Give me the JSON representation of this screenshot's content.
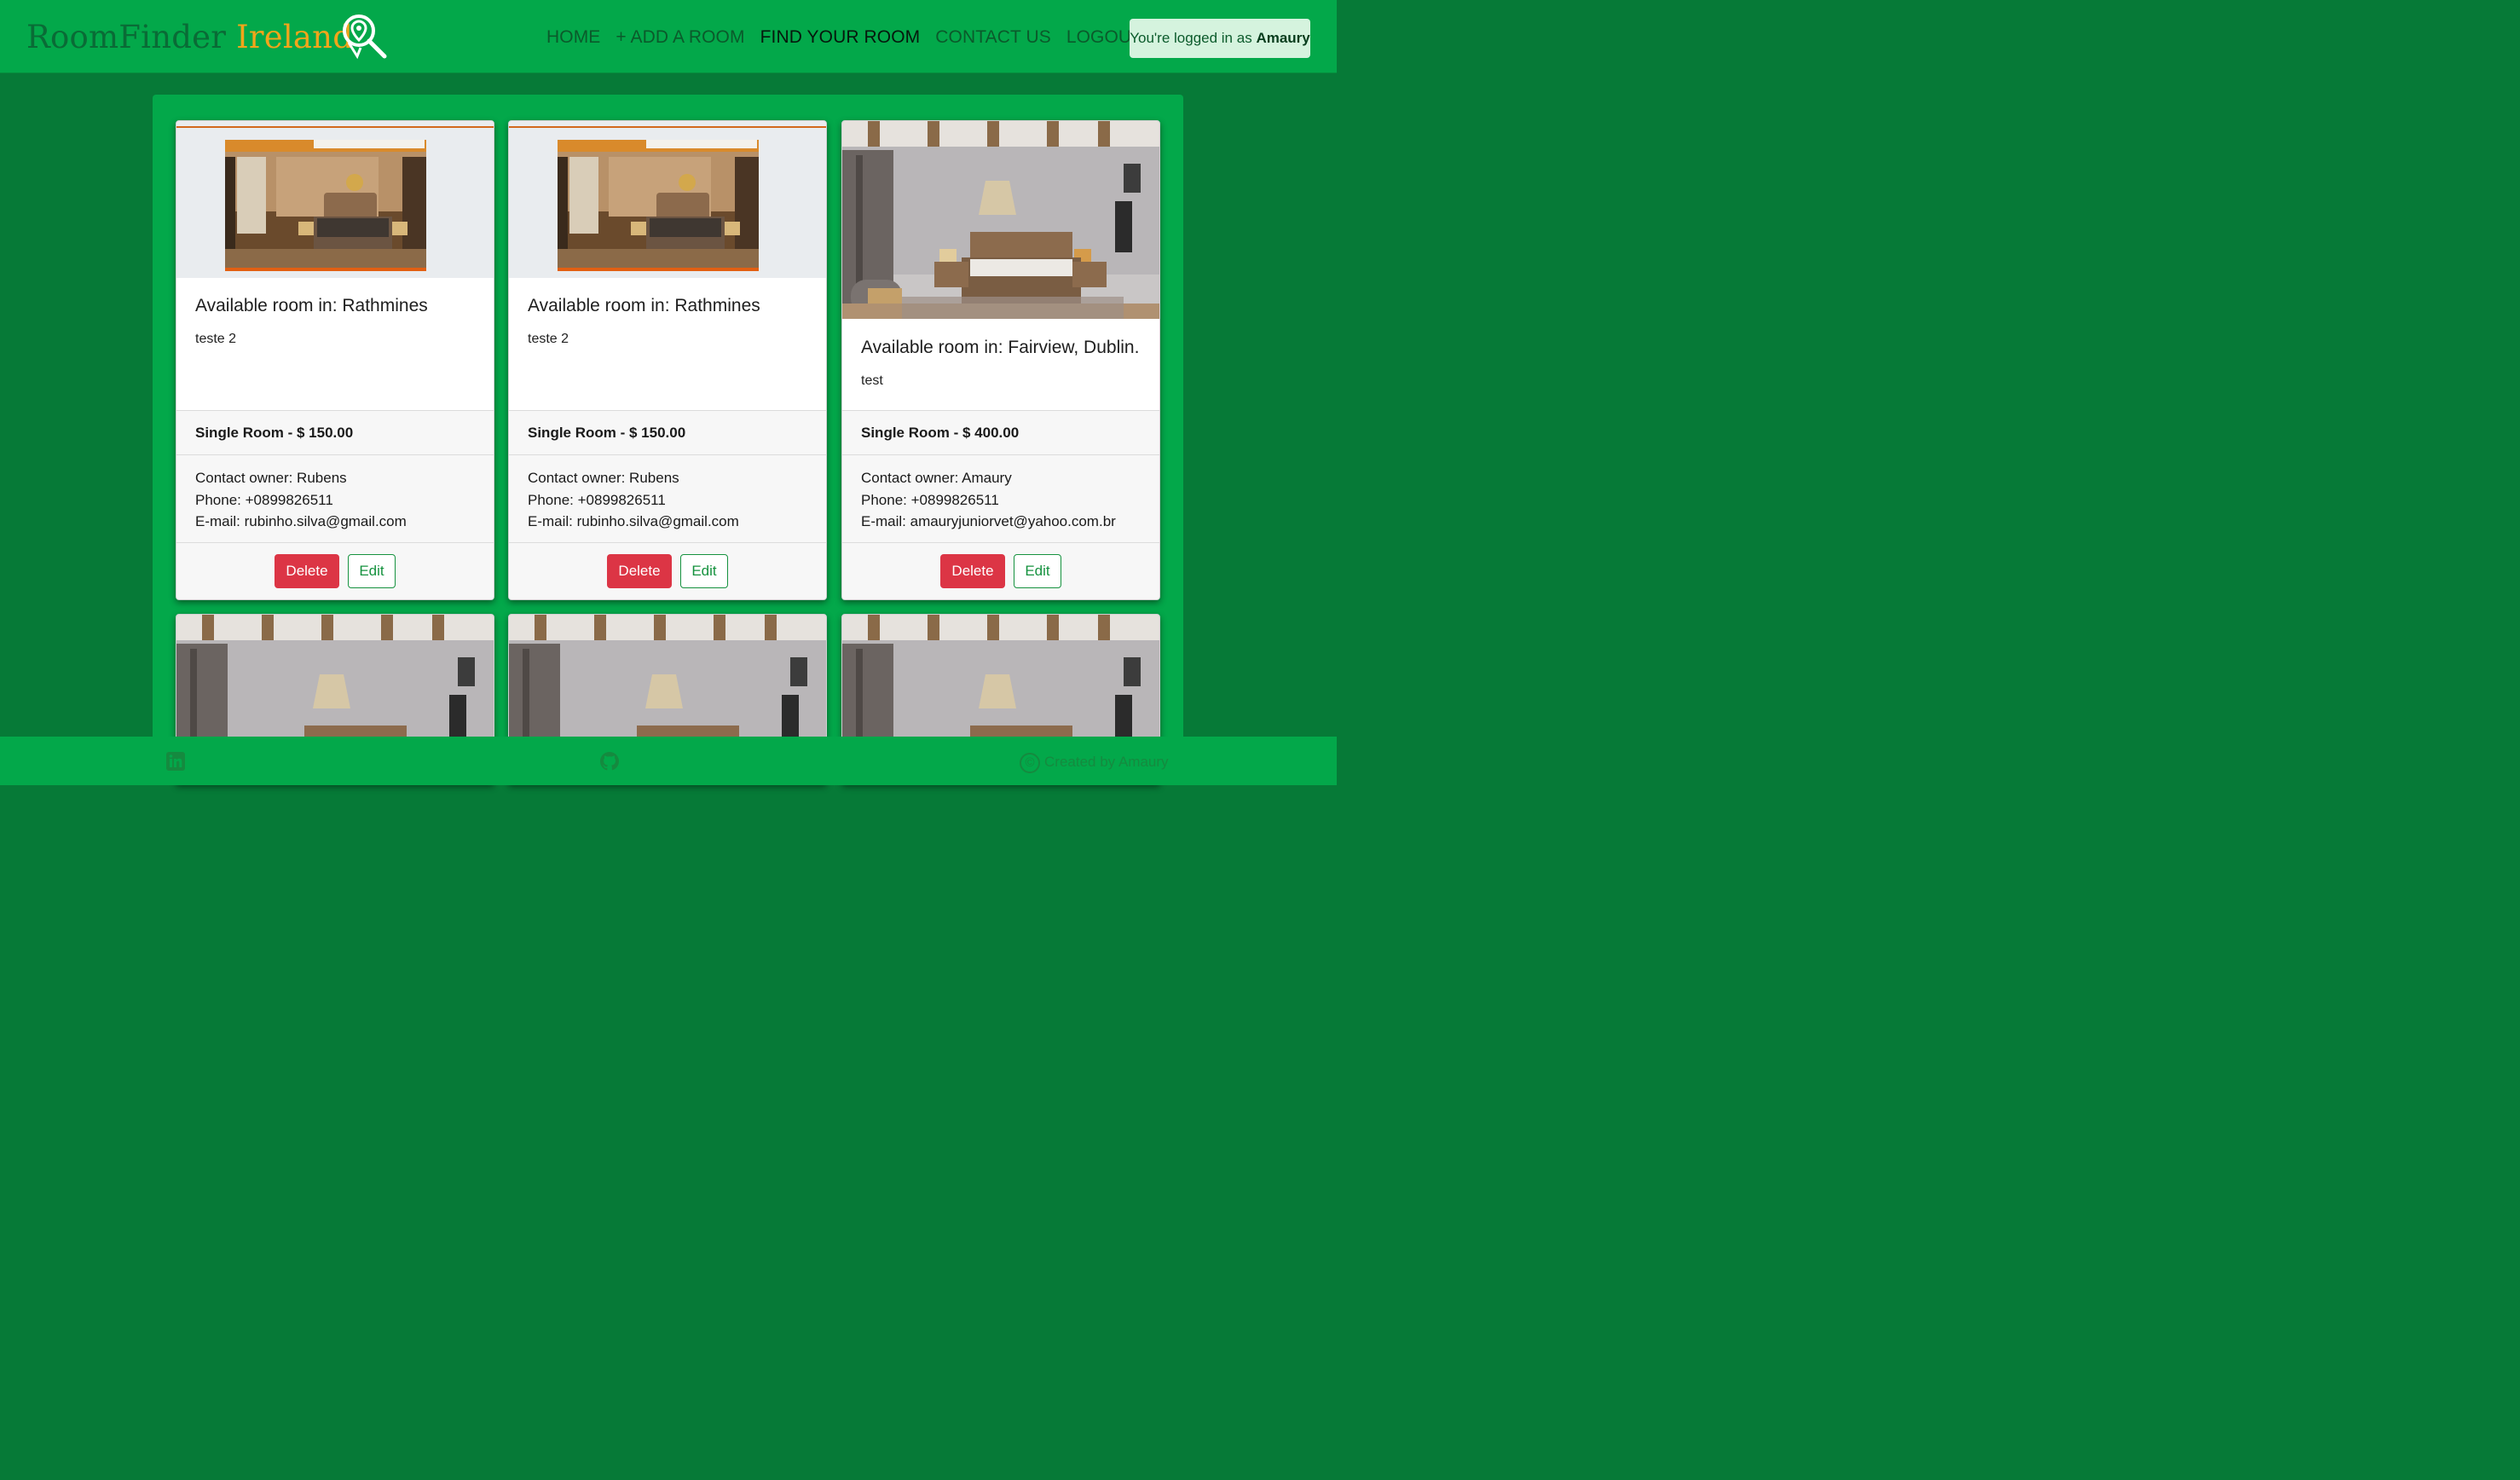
{
  "brand": {
    "part1": "RoomFinder",
    "part2": "Ireland",
    "logo_icon": "location-search-icon"
  },
  "nav": {
    "items": [
      {
        "label": "HOME",
        "active": false
      },
      {
        "label": "+ ADD A ROOM",
        "active": false
      },
      {
        "label": "FIND YOUR ROOM",
        "active": true
      },
      {
        "label": "CONTACT US",
        "active": false
      },
      {
        "label": "LOGOUT",
        "active": false
      }
    ],
    "login_prefix": "You're logged in as",
    "login_user": "Amaury"
  },
  "cards": [
    {
      "title": "Available room in: Rathmines",
      "description": "teste 2",
      "price": "Single Room - $ 150.00",
      "owner": "Contact owner: Rubens",
      "phone": "Phone: +0899826511",
      "email": "E-mail: rubinho.silva@gmail.com",
      "delete_label": "Delete",
      "edit_label": "Edit"
    },
    {
      "title": "Available room in: Rathmines",
      "description": "teste 2",
      "price": "Single Room - $ 150.00",
      "owner": "Contact owner: Rubens",
      "phone": "Phone: +0899826511",
      "email": "E-mail: rubinho.silva@gmail.com",
      "delete_label": "Delete",
      "edit_label": "Edit"
    },
    {
      "title": "Available room in: Fairview, Dublin.",
      "description": "test",
      "price": "Single Room - $ 400.00",
      "owner": "Contact owner: Amaury",
      "phone": "Phone: +0899826511",
      "email": "E-mail: amauryjuniorvet@yahoo.com.br",
      "delete_label": "Delete",
      "edit_label": "Edit"
    }
  ],
  "footer": {
    "credit": "Created by Amaury",
    "icons": [
      "linkedin-icon",
      "github-icon",
      "copyright-icon"
    ]
  },
  "colors": {
    "header_bg": "#03a84a",
    "page_bg": "#067a37",
    "brand_accent": "#f2a51a",
    "delete": "#dc3545",
    "edit": "#16923f"
  }
}
